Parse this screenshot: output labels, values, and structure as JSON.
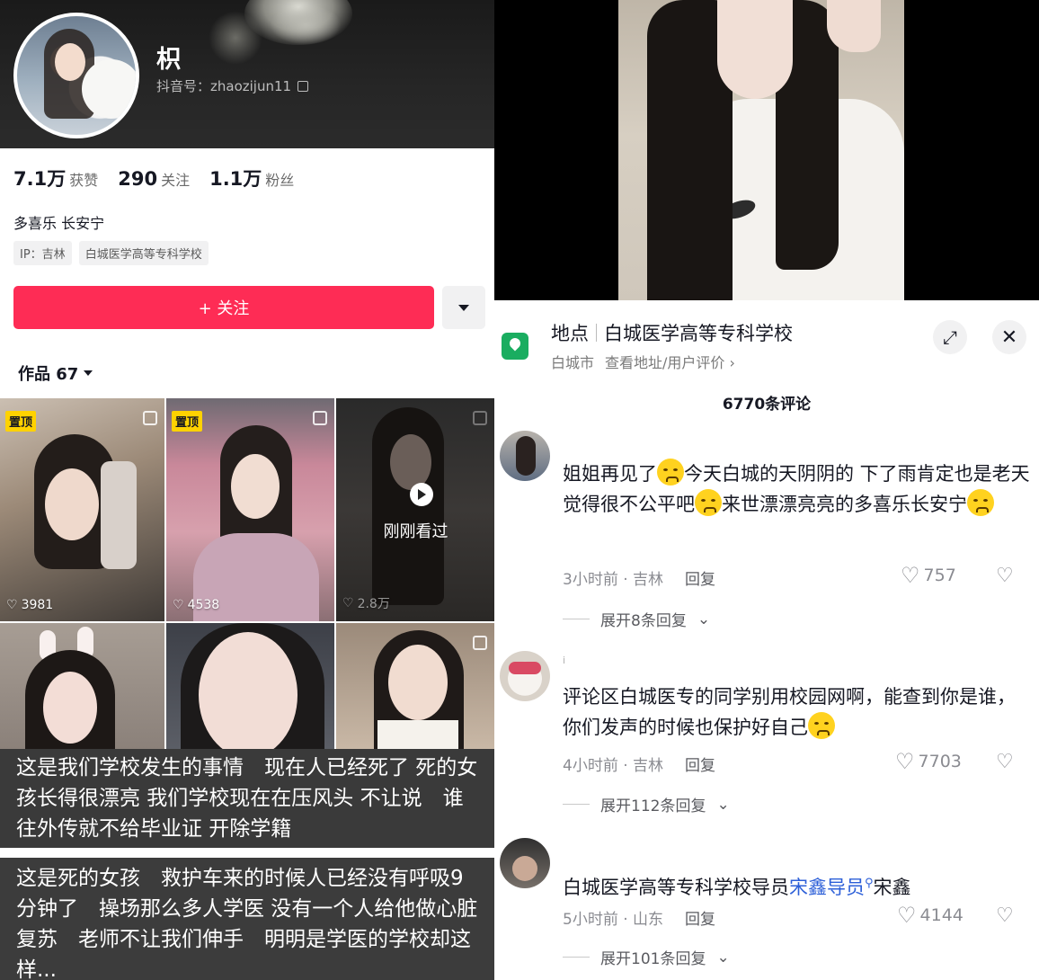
{
  "profile": {
    "nickname": "枳",
    "douyin_id": "抖音号：zhaozijun11",
    "stats": [
      {
        "value": "7.1万",
        "label": "获赞"
      },
      {
        "value": "290",
        "label": "关注"
      },
      {
        "value": "1.1万",
        "label": "粉丝"
      }
    ],
    "bio": "多喜乐 长安宁",
    "tags": [
      "IP：吉林",
      "白城医学高等专科学校"
    ],
    "follow_label": "+ 关注",
    "works_tab": "作品 67"
  },
  "grid": {
    "pinned_label": "置顶",
    "items": [
      {
        "likes": "3981",
        "pinned": true
      },
      {
        "likes": "4538",
        "pinned": true
      },
      {
        "likes": "2.8万",
        "pinned": false
      }
    ],
    "watched_label": "刚刚看过"
  },
  "captions": {
    "first": "这是我们学校发生的事情　现在人已经死了 死的女孩长得很漂亮 我们学校现在在压风头 不让说　谁往外传就不给毕业证 开除学籍",
    "second": "这是死的女孩　救护车来的时候人已经没有呼吸9分钟了　操场那么多人学医 没有一个人给他做心脏复苏　老师不让我们伸手　明明是学医的学校却这样..."
  },
  "location": {
    "title_prefix": "地点",
    "title": "白城医学高等专科学校",
    "city": "白城市",
    "sub_link": "查看地址/用户评价 ›"
  },
  "comments_count": "6770条评论",
  "comments": [
    {
      "text_parts": [
        "姐姐再见了",
        "今天白城的天阴阴的 下了雨肯定也是老天觉得很不公平吧",
        "来世漂漂亮亮的多喜乐长安宁",
        ""
      ],
      "time": "3小时前 · 吉林",
      "reply": "回复",
      "likes": "757",
      "expand": "展开8条回复"
    },
    {
      "tiny": "i",
      "text_parts": [
        "评论区白城医专的同学别用校园网啊，能查到你是谁，你们发声的时候也保护好自己"
      ],
      "time": "4小时前 · 吉林",
      "reply": "回复",
      "likes": "7703",
      "expand": "展开112条回复"
    },
    {
      "text_prefix": "白城医学高等专科学校导员",
      "text_link": "宋鑫导员",
      "text_suffix": "宋鑫",
      "time": "5小时前 · 山东",
      "reply": "回复",
      "likes": "4144",
      "expand": "展开101条回复"
    }
  ],
  "colors": {
    "accent": "#fe2c55",
    "pin": "#ffd200",
    "location_icon": "#1aad60",
    "link": "#2c5fd8"
  }
}
